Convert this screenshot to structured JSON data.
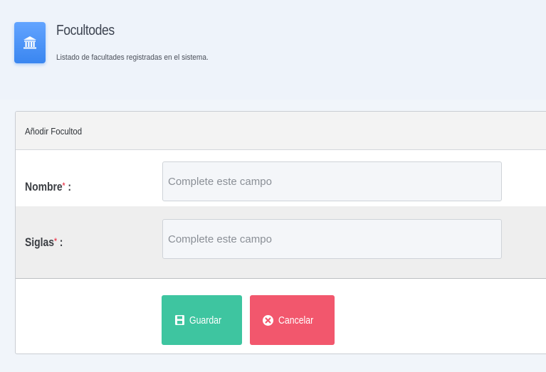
{
  "header": {
    "icon": "institution-icon",
    "title": "Focultodes",
    "subtitle": "Listado de facultades registradas en el sistema."
  },
  "card": {
    "heading": "Añodir Focultod",
    "fields": [
      {
        "label": "Nombre",
        "required_mark": "*",
        "separator": " :",
        "value": "",
        "placeholder": "Complete este campo"
      },
      {
        "label": "Siglas",
        "required_mark": "*",
        "separator": " :",
        "value": "",
        "placeholder": "Complete este campo"
      }
    ]
  },
  "actions": {
    "save_label": "Guardar",
    "save_icon": "save-icon",
    "cancel_label": "Cancelar",
    "cancel_icon": "cancel-circle-icon"
  },
  "colors": {
    "accent_blue": "#3a86f0",
    "save_green": "#3ec5a0",
    "cancel_red": "#f2576d",
    "required_red": "#ec4a5c"
  }
}
